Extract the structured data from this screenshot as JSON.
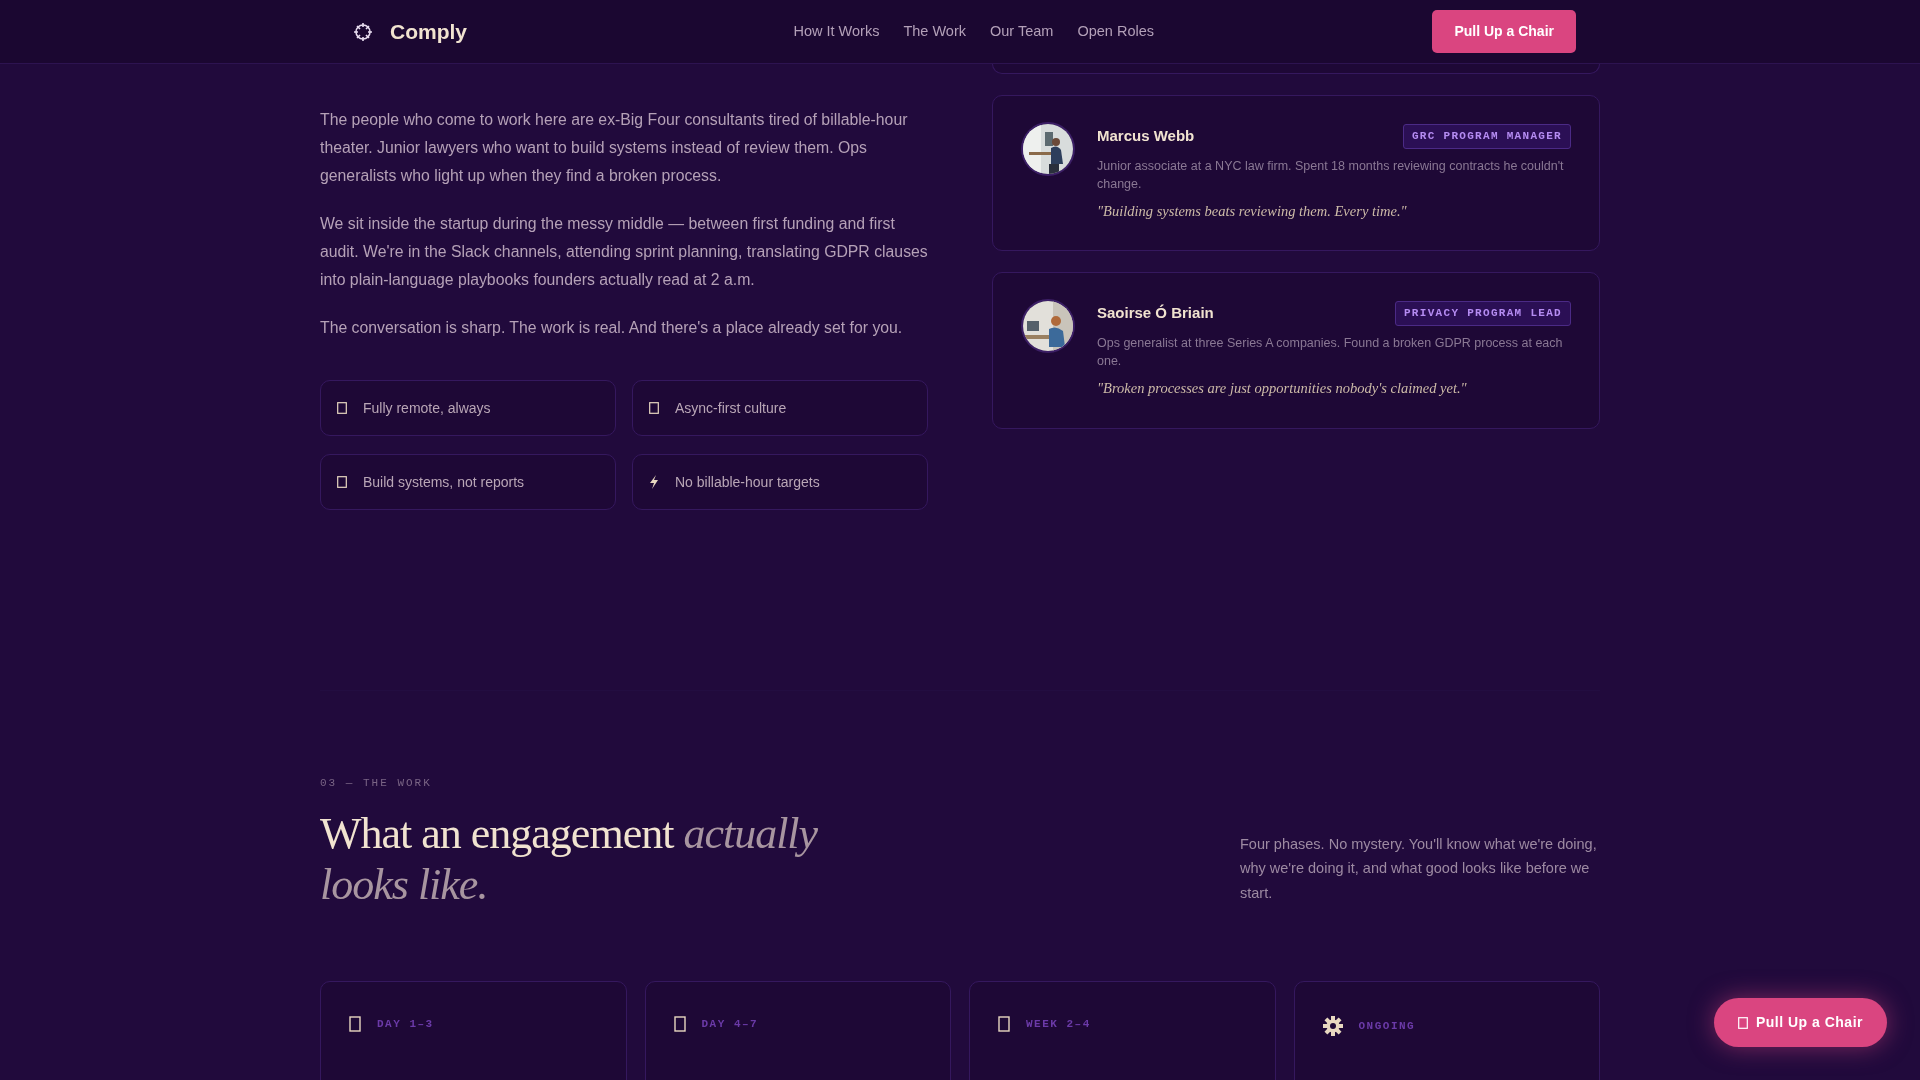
{
  "nav": {
    "brand": "Comply",
    "links": [
      "How It Works",
      "The Work",
      "Our Team",
      "Open Roles"
    ],
    "cta": "Pull Up a Chair"
  },
  "intro": {
    "paragraphs": [
      "The people who come to work here are ex-Big Four consultants tired of billable-hour theater. Junior lawyers who want to build systems instead of review them. Ops generalists who light up when they find a broken process.",
      "We sit inside the startup during the messy middle — between first funding and first audit. We're in the Slack channels, attending sprint planning, translating GDPR clauses into plain-language playbooks founders actually read at 2 a.m.",
      "The conversation is sharp. The work is real. And there's a place already set for you."
    ],
    "perks": [
      {
        "kind": "box",
        "label": "Fully remote, always"
      },
      {
        "kind": "box",
        "label": "Async-first culture"
      },
      {
        "kind": "box",
        "label": "Build systems, not reports"
      },
      {
        "kind": "bolt",
        "label": "No billable-hour targets"
      }
    ]
  },
  "team": [
    {
      "name": "Marcus Webb",
      "role": "GRC PROGRAM MANAGER",
      "bio": "Junior associate at a NYC law firm. Spent 18 months reviewing contracts he couldn't change.",
      "quote": "\"Building systems beats reviewing them. Every time.\""
    },
    {
      "name": "Saoirse Ó Briain",
      "role": "PRIVACY PROGRAM LEAD",
      "bio": "Ops generalist at three Series A companies. Found a broken GDPR process at each one.",
      "quote": "\"Broken processes are just opportunities nobody's claimed yet.\""
    }
  ],
  "work": {
    "eyebrow": "03 — THE WORK",
    "heading": "What an engagement *actually looks like.*",
    "lede": "Four phases. No mystery. You'll know what we're doing, why we're doing it, and what good looks like before we start.",
    "phases": [
      {
        "kind": "box",
        "label": "DAY 1–3"
      },
      {
        "kind": "box",
        "label": "DAY 4–7"
      },
      {
        "kind": "box",
        "label": "WEEK 2–4"
      },
      {
        "kind": "gear",
        "label": "ONGOING"
      }
    ]
  },
  "floating_cta": {
    "kind": "box",
    "label": "Pull Up a Chair"
  }
}
